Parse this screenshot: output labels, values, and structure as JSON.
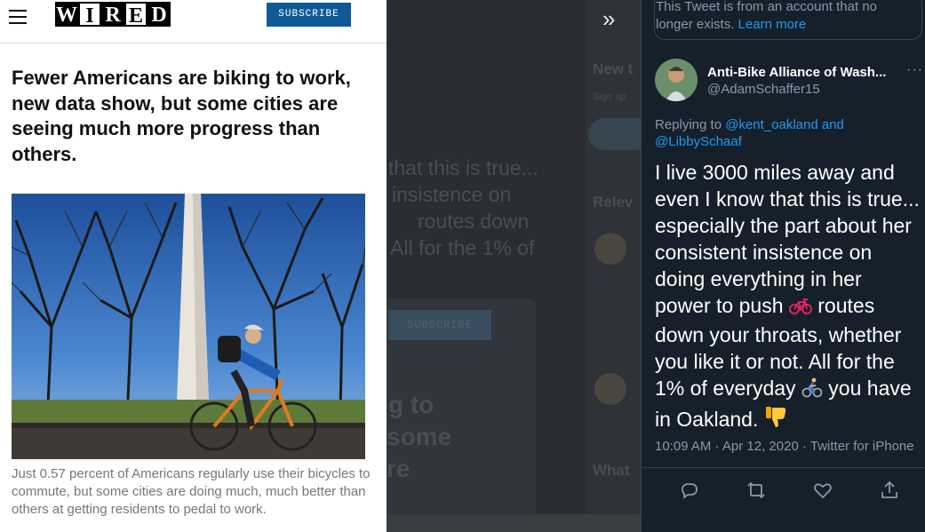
{
  "article": {
    "logo_letters": [
      "W",
      "I",
      "R",
      "E",
      "D"
    ],
    "subscribe_label": "SUBSCRIBE",
    "headline": "Fewer Americans are biking to work, new data show, but some cities are seeing much more progress than others.",
    "caption": "Just 0.57 percent of Americans regularly use their bicycles to commute, but some cities are doing much, much better than others at getting residents to pedal to work."
  },
  "background_page": {
    "fragments": [
      "that this is true...",
      "insistence on",
      "routes down",
      "All for the 1% of",
      "g to",
      "some",
      "re"
    ],
    "sidebar_fragments": [
      "New t",
      "Sign up",
      "Relev",
      "What"
    ],
    "subscribe_label": "SUBSCRIBE"
  },
  "tweet": {
    "quoted_notice": "This Tweet is from an account that no longer exists.",
    "learn_more": "Learn more",
    "author_name": "Anti-Bike Alliance of Wash...",
    "author_handle": "@AdamSchaffer15",
    "replying_prefix": "Replying to",
    "replying_to": [
      "@kent_oakland",
      "and",
      "@LibbySchaaf"
    ],
    "text_parts": [
      "I live 3000 miles away and even I know that this is true... especially the part about her consistent insistence on doing everything in her power to push ",
      " routes down your throats, whether you like it or not. All for the 1% of everyday ",
      " you have in Oakland. "
    ],
    "emoji_icons": [
      "bicycle-icon",
      "cyclist-icon",
      "thumbs-down-icon"
    ],
    "time": "10:09 AM",
    "date": "Apr 12, 2020",
    "source": "Twitter for iPhone",
    "colors": {
      "background": "#15202b",
      "link": "#1d9bf0",
      "muted": "#8899a6"
    }
  }
}
